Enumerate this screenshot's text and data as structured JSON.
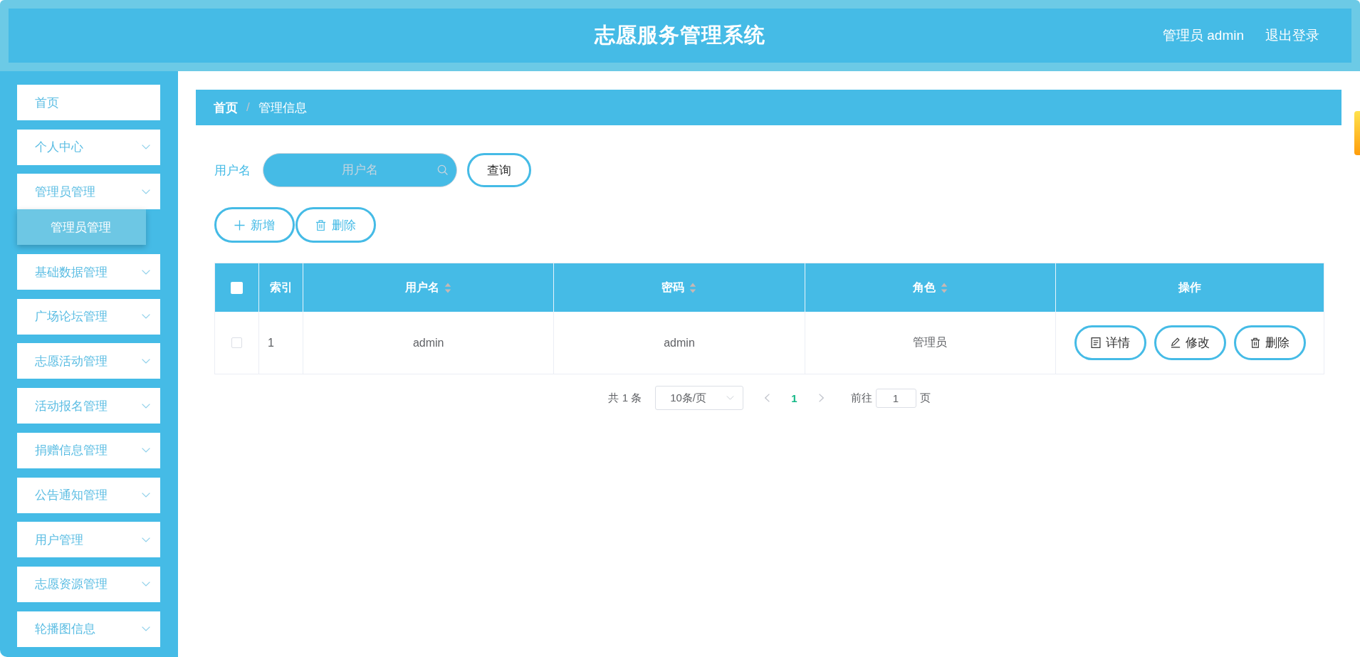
{
  "header": {
    "title": "志愿服务管理系统",
    "user": "管理员 admin",
    "logout": "退出登录"
  },
  "sidebar": {
    "items": [
      {
        "label": "首页",
        "kind": "link"
      },
      {
        "label": "个人中心",
        "kind": "menu"
      },
      {
        "label": "管理员管理",
        "kind": "menu",
        "children": [
          {
            "label": "管理员管理"
          }
        ]
      },
      {
        "label": "基础数据管理",
        "kind": "menu"
      },
      {
        "label": "广场论坛管理",
        "kind": "menu"
      },
      {
        "label": "志愿活动管理",
        "kind": "menu"
      },
      {
        "label": "活动报名管理",
        "kind": "menu"
      },
      {
        "label": "捐赠信息管理",
        "kind": "menu"
      },
      {
        "label": "公告通知管理",
        "kind": "menu"
      },
      {
        "label": "用户管理",
        "kind": "menu"
      },
      {
        "label": "志愿资源管理",
        "kind": "menu"
      },
      {
        "label": "轮播图信息",
        "kind": "menu"
      }
    ]
  },
  "breadcrumb": {
    "separator": "/",
    "items": [
      {
        "label": "首页",
        "kind": "link"
      },
      {
        "label": "管理信息",
        "kind": "current"
      }
    ]
  },
  "search": {
    "label": "用户名",
    "placeholder": "用户名",
    "button": "查询"
  },
  "actions": [
    {
      "label": "新增",
      "kind": "add"
    },
    {
      "label": "删除",
      "kind": "delete"
    }
  ],
  "table": {
    "select_all": {
      "checked": false
    },
    "columns": [
      {
        "label": "索引",
        "sortable": false
      },
      {
        "label": "用户名",
        "sortable": true
      },
      {
        "label": "密码",
        "sortable": true
      },
      {
        "label": "角色",
        "sortable": true
      },
      {
        "label": "操作",
        "sortable": false
      }
    ],
    "rows": [
      {
        "checked": false,
        "cells": [
          "1",
          "admin",
          "admin",
          "管理员"
        ],
        "actions": [
          {
            "label": "详情",
            "kind": "view"
          },
          {
            "label": "修改",
            "kind": "edit"
          },
          {
            "label": "删除",
            "kind": "delete"
          }
        ]
      }
    ]
  },
  "pagination": {
    "total": "共 1 条",
    "page_size": "10条/页",
    "prev": {
      "disabled": true
    },
    "pages": [
      {
        "label": "1",
        "selected": true
      }
    ],
    "next": {
      "disabled": true
    },
    "goto_label": "前往",
    "goto_value": "1",
    "goto_suffix": "页"
  }
}
